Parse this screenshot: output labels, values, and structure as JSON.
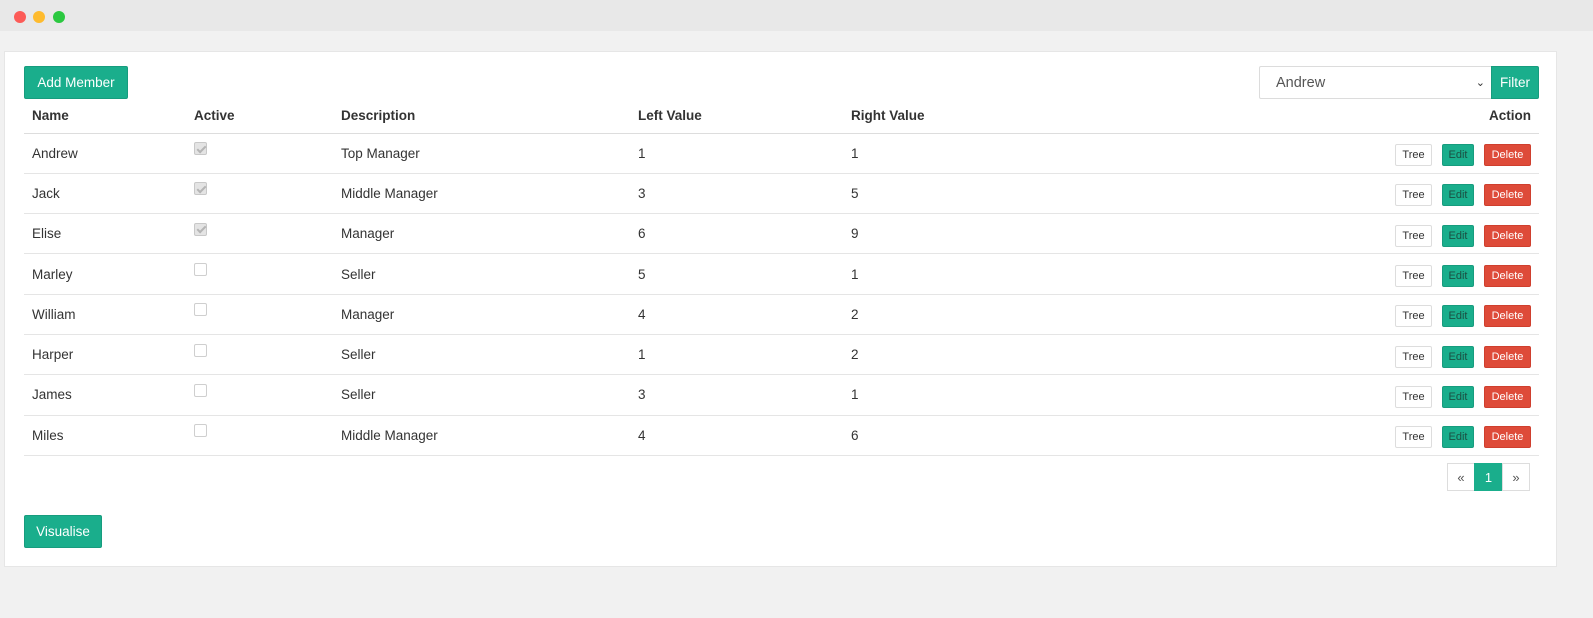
{
  "toolbar": {
    "add_label": "Add Member",
    "filter_label": "Filter",
    "select_value": "Andrew"
  },
  "table": {
    "headers": [
      "Name",
      "Active",
      "Description",
      "Left Value",
      "Right Value",
      "Action"
    ],
    "rows": [
      {
        "name": "Andrew",
        "active": true,
        "description": "Top Manager",
        "left": "1",
        "right": "1"
      },
      {
        "name": "Jack",
        "active": true,
        "description": "Middle Manager",
        "left": "3",
        "right": "5"
      },
      {
        "name": "Elise",
        "active": true,
        "description": "Manager",
        "left": "6",
        "right": "9"
      },
      {
        "name": "Marley",
        "active": false,
        "description": "Seller",
        "left": "5",
        "right": "1"
      },
      {
        "name": "William",
        "active": false,
        "description": "Manager",
        "left": "4",
        "right": "2"
      },
      {
        "name": "Harper",
        "active": false,
        "description": "Seller",
        "left": "1",
        "right": "2"
      },
      {
        "name": "James",
        "active": false,
        "description": "Seller",
        "left": "3",
        "right": "1"
      },
      {
        "name": "Miles",
        "active": false,
        "description": "Middle Manager",
        "left": "4",
        "right": "6"
      }
    ],
    "row_actions": {
      "tree": "Tree",
      "edit": "Edit",
      "delete": "Delete"
    }
  },
  "pagination": {
    "prev": "«",
    "current": "1",
    "next": "»"
  },
  "footer": {
    "visualise_label": "Visualise"
  },
  "colors": {
    "accent": "#1aae8c",
    "danger": "#de4b39"
  }
}
